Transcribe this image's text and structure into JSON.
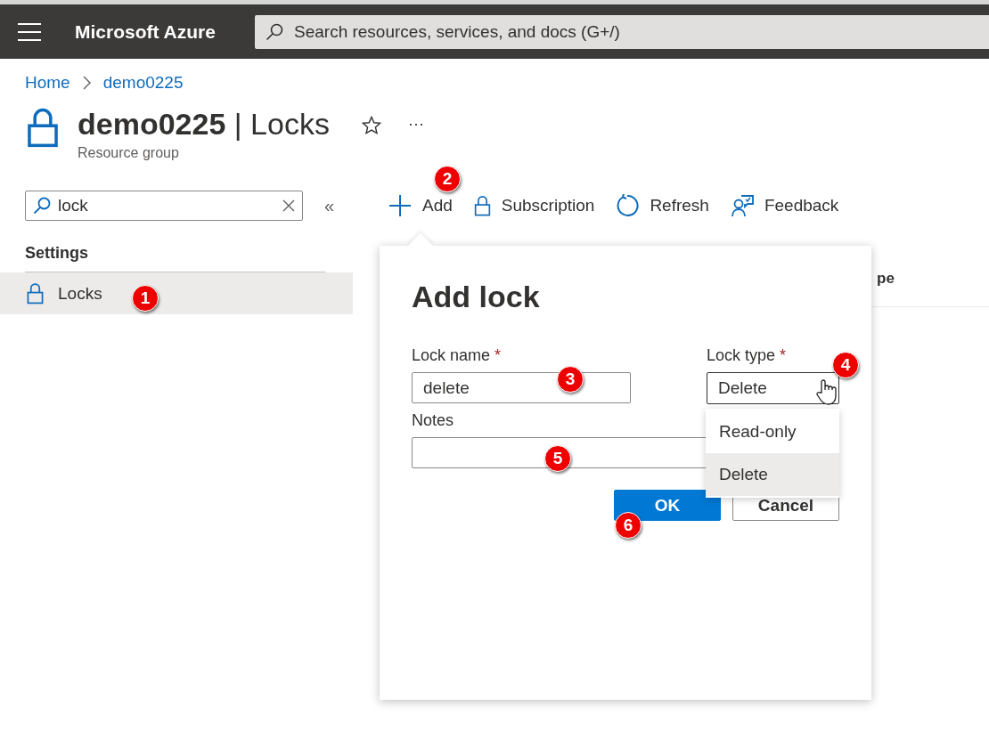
{
  "top_bar": {
    "brand": "Microsoft Azure",
    "search": {
      "placeholder": "Search resources, services, and docs (G+/)"
    }
  },
  "breadcrumb": [
    "Home",
    "demo0225"
  ],
  "header": {
    "title": "demo0225",
    "separator": "|",
    "section": "Locks",
    "subtitle": "Resource group",
    "more": "···"
  },
  "sidebar": {
    "search": {
      "value": "lock"
    },
    "collapse": "«",
    "groups": [
      {
        "title": "Settings",
        "items": [
          {
            "label": "Locks",
            "selected": true
          }
        ]
      }
    ]
  },
  "toolbar": [
    {
      "kind": "add",
      "label": "Add"
    },
    {
      "kind": "lock",
      "label": "Subscription"
    },
    {
      "kind": "refresh",
      "label": "Refresh"
    },
    {
      "kind": "feedback",
      "label": "Feedback"
    }
  ],
  "table": {
    "column_2": "pe"
  },
  "add_lock_panel": {
    "title": "Add lock",
    "lock_name": {
      "label": "Lock name",
      "required_mark": "*",
      "value": "delete"
    },
    "lock_type": {
      "label": "Lock type",
      "required_mark": "*",
      "value": "Delete",
      "expanded": true,
      "options": [
        {
          "label": "Read-only",
          "selected": false
        },
        {
          "label": "Delete",
          "selected": true
        }
      ]
    },
    "notes": {
      "label": "Notes"
    },
    "buttons": [
      {
        "kind": "primary",
        "label": "OK"
      },
      {
        "kind": "secondary",
        "label": "Cancel"
      }
    ]
  },
  "annotations": [
    "1",
    "2",
    "3",
    "4",
    "5",
    "6"
  ]
}
